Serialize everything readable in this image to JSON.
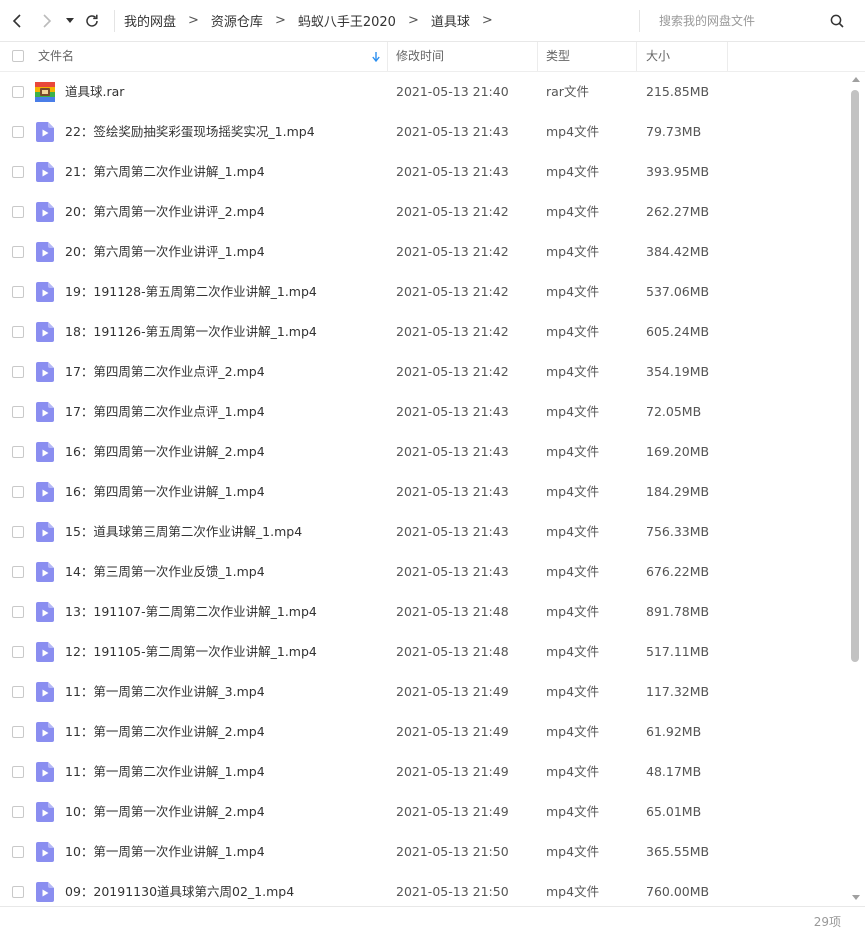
{
  "breadcrumbs": [
    "我的网盘",
    "资源仓库",
    "蚂蚁八手王2020",
    "道具球"
  ],
  "search": {
    "placeholder": "搜索我的网盘文件"
  },
  "columns": {
    "name": "文件名",
    "time": "修改时间",
    "type": "类型",
    "size": "大小"
  },
  "files": [
    {
      "name": "道具球.rar",
      "time": "2021-05-13 21:40",
      "type": "rar文件",
      "size": "215.85MB",
      "icon": "archive-icon"
    },
    {
      "name": "22：签绘奖励抽奖彩蛋现场摇奖实况_1.mp4",
      "time": "2021-05-13 21:43",
      "type": "mp4文件",
      "size": "79.73MB",
      "icon": "video-icon"
    },
    {
      "name": "21：第六周第二次作业讲解_1.mp4",
      "time": "2021-05-13 21:43",
      "type": "mp4文件",
      "size": "393.95MB",
      "icon": "video-icon"
    },
    {
      "name": "20：第六周第一次作业讲评_2.mp4",
      "time": "2021-05-13 21:42",
      "type": "mp4文件",
      "size": "262.27MB",
      "icon": "video-icon"
    },
    {
      "name": "20：第六周第一次作业讲评_1.mp4",
      "time": "2021-05-13 21:42",
      "type": "mp4文件",
      "size": "384.42MB",
      "icon": "video-icon"
    },
    {
      "name": "19：191128-第五周第二次作业讲解_1.mp4",
      "time": "2021-05-13 21:42",
      "type": "mp4文件",
      "size": "537.06MB",
      "icon": "video-icon"
    },
    {
      "name": "18：191126-第五周第一次作业讲解_1.mp4",
      "time": "2021-05-13 21:42",
      "type": "mp4文件",
      "size": "605.24MB",
      "icon": "video-icon"
    },
    {
      "name": "17：第四周第二次作业点评_2.mp4",
      "time": "2021-05-13 21:42",
      "type": "mp4文件",
      "size": "354.19MB",
      "icon": "video-icon"
    },
    {
      "name": "17：第四周第二次作业点评_1.mp4",
      "time": "2021-05-13 21:43",
      "type": "mp4文件",
      "size": "72.05MB",
      "icon": "video-icon"
    },
    {
      "name": "16：第四周第一次作业讲解_2.mp4",
      "time": "2021-05-13 21:43",
      "type": "mp4文件",
      "size": "169.20MB",
      "icon": "video-icon"
    },
    {
      "name": "16：第四周第一次作业讲解_1.mp4",
      "time": "2021-05-13 21:43",
      "type": "mp4文件",
      "size": "184.29MB",
      "icon": "video-icon"
    },
    {
      "name": "15：道具球第三周第二次作业讲解_1.mp4",
      "time": "2021-05-13 21:43",
      "type": "mp4文件",
      "size": "756.33MB",
      "icon": "video-icon"
    },
    {
      "name": "14：第三周第一次作业反馈_1.mp4",
      "time": "2021-05-13 21:43",
      "type": "mp4文件",
      "size": "676.22MB",
      "icon": "video-icon"
    },
    {
      "name": "13：191107-第二周第二次作业讲解_1.mp4",
      "time": "2021-05-13 21:48",
      "type": "mp4文件",
      "size": "891.78MB",
      "icon": "video-icon"
    },
    {
      "name": "12：191105-第二周第一次作业讲解_1.mp4",
      "time": "2021-05-13 21:48",
      "type": "mp4文件",
      "size": "517.11MB",
      "icon": "video-icon"
    },
    {
      "name": "11：第一周第二次作业讲解_3.mp4",
      "time": "2021-05-13 21:49",
      "type": "mp4文件",
      "size": "117.32MB",
      "icon": "video-icon"
    },
    {
      "name": "11：第一周第二次作业讲解_2.mp4",
      "time": "2021-05-13 21:49",
      "type": "mp4文件",
      "size": "61.92MB",
      "icon": "video-icon"
    },
    {
      "name": "11：第一周第二次作业讲解_1.mp4",
      "time": "2021-05-13 21:49",
      "type": "mp4文件",
      "size": "48.17MB",
      "icon": "video-icon"
    },
    {
      "name": "10：第一周第一次作业讲解_2.mp4",
      "time": "2021-05-13 21:49",
      "type": "mp4文件",
      "size": "65.01MB",
      "icon": "video-icon"
    },
    {
      "name": "10：第一周第一次作业讲解_1.mp4",
      "time": "2021-05-13 21:50",
      "type": "mp4文件",
      "size": "365.55MB",
      "icon": "video-icon"
    },
    {
      "name": "09：20191130道具球第六周02_1.mp4",
      "time": "2021-05-13 21:50",
      "type": "mp4文件",
      "size": "760.00MB",
      "icon": "video-icon"
    }
  ],
  "footer": {
    "count": "29项"
  },
  "colors": {
    "video_icon": "#8a8ef0",
    "sort_arrow": "#2b8ff0",
    "scroll_thumb": "#c2c2c2"
  }
}
